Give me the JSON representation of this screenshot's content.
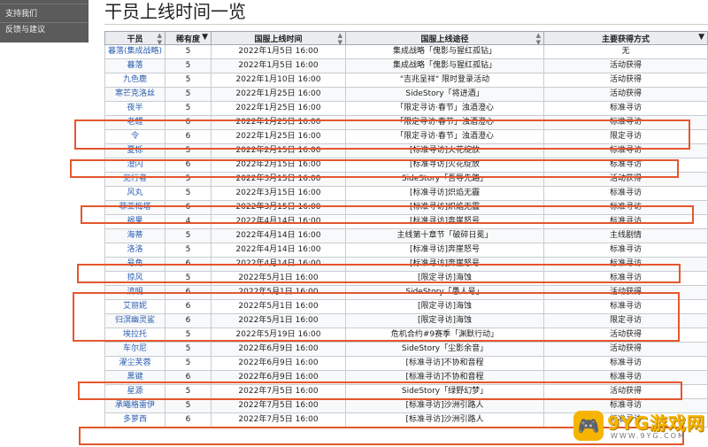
{
  "sidebar": {
    "items": [
      "支持我们",
      "反馈与建议"
    ]
  },
  "page_title": "干员上线时间一览",
  "table": {
    "columns": [
      {
        "label": "干员",
        "control": "sort"
      },
      {
        "label": "稀有度",
        "control": "filter"
      },
      {
        "label": "国服上线时间",
        "control": "sort"
      },
      {
        "label": "国服上线途径",
        "control": "sort"
      },
      {
        "label": "主要获得方式",
        "control": "filter"
      }
    ],
    "rows": [
      [
        "暮落(集成战略)",
        "5",
        "2022年1月5日 16:00",
        "集成战略「傀影与猩红孤钻」",
        "无"
      ],
      [
        "暮落",
        "5",
        "2022年1月5日 16:00",
        "集成战略「傀影与猩红孤钻」",
        "活动获得"
      ],
      [
        "九色鹿",
        "5",
        "2022年1月10日 16:00",
        "\"吉兆呈祥\" 限时登录活动",
        "活动获得"
      ],
      [
        "寒芒克洛丝",
        "5",
        "2022年1月25日 16:00",
        "SideStory「将进酒」",
        "活动获得"
      ],
      [
        "夜半",
        "5",
        "2022年1月25日 16:00",
        "「限定寻访·春节」浊酒澄心",
        "标准寻访"
      ],
      [
        "老鲤",
        "6",
        "2022年1月25日 16:00",
        "「限定寻访·春节」浊酒澄心",
        "标准寻访"
      ],
      [
        "令",
        "6",
        "2022年1月25日 16:00",
        "「限定寻访·春节」浊酒澄心",
        "限定寻访"
      ],
      [
        "夏栎",
        "5",
        "2022年2月15日 16:00",
        "[标准寻访]火花绽放",
        "标准寻访"
      ],
      [
        "澄闪",
        "6",
        "2022年2月15日 16:00",
        "[标准寻访]火花绽放",
        "标准寻访"
      ],
      [
        "见行者",
        "5",
        "2022年3月15日 16:00",
        "SideStory「吾导先路」",
        "活动获得"
      ],
      [
        "风丸",
        "5",
        "2022年3月15日 16:00",
        "[标准寻访]炽焰无霾",
        "标准寻访"
      ],
      [
        "菲亚梅塔",
        "6",
        "2022年3月15日 16:00",
        "[标准寻访]炽焰无霾",
        "标准寻访"
      ],
      [
        "褐果",
        "4",
        "2022年4月14日 16:00",
        "[标准寻访]奔崖怒号",
        "标准寻访"
      ],
      [
        "海蒂",
        "5",
        "2022年4月14日 16:00",
        "主线第十章节「破碎日冕」",
        "主线剧情"
      ],
      [
        "洛洛",
        "5",
        "2022年4月14日 16:00",
        "[标准寻访]奔崖怒号",
        "标准寻访"
      ],
      [
        "号角",
        "6",
        "2022年4月14日 16:00",
        "[标准寻访]奔崖怒号",
        "标准寻访"
      ],
      [
        "掠风",
        "5",
        "2022年5月1日 16:00",
        "[限定寻访]海蚀",
        "标准寻访"
      ],
      [
        "流明",
        "6",
        "2022年5月1日 16:00",
        "SideStory「愚人号」",
        "活动获得"
      ],
      [
        "艾丽妮",
        "6",
        "2022年5月1日 16:00",
        "[限定寻访]海蚀",
        "标准寻访"
      ],
      [
        "归溟幽灵鲨",
        "6",
        "2022年5月1日 16:00",
        "[限定寻访]海蚀",
        "限定寻访"
      ],
      [
        "埃拉托",
        "5",
        "2022年5月19日 16:00",
        "危机合约#9赛季「渊默行动」",
        "活动获得"
      ],
      [
        "车尔尼",
        "5",
        "2022年6月9日 16:00",
        "SideStory「尘影余音」",
        "活动获得"
      ],
      [
        "濯尘芙蓉",
        "5",
        "2022年6月9日 16:00",
        "[标准寻访]不协和音程",
        "标准寻访"
      ],
      [
        "黑键",
        "6",
        "2022年6月9日 16:00",
        "[标准寻访]不协和音程",
        "标准寻访"
      ],
      [
        "星源",
        "5",
        "2022年7月5日 16:00",
        "SideStory「绿野幻梦」",
        "活动获得"
      ],
      [
        "承曦格雷伊",
        "5",
        "2022年7月5日 16:00",
        "[标准寻访]沙洲引路人",
        "标准寻访"
      ],
      [
        "多萝西",
        "6",
        "2022年7月5日 16:00",
        "[标准寻访]沙洲引路人",
        "标准寻访"
      ]
    ]
  },
  "watermark": {
    "brand": "9YG游戏网",
    "url": "WWW.9YG.COM"
  },
  "colors": {
    "highlight_box": "#e4572e",
    "operator_link": "#2a5db0",
    "header_bg": "#eaecf0",
    "sidebar_bg": "#5b5b5b"
  }
}
